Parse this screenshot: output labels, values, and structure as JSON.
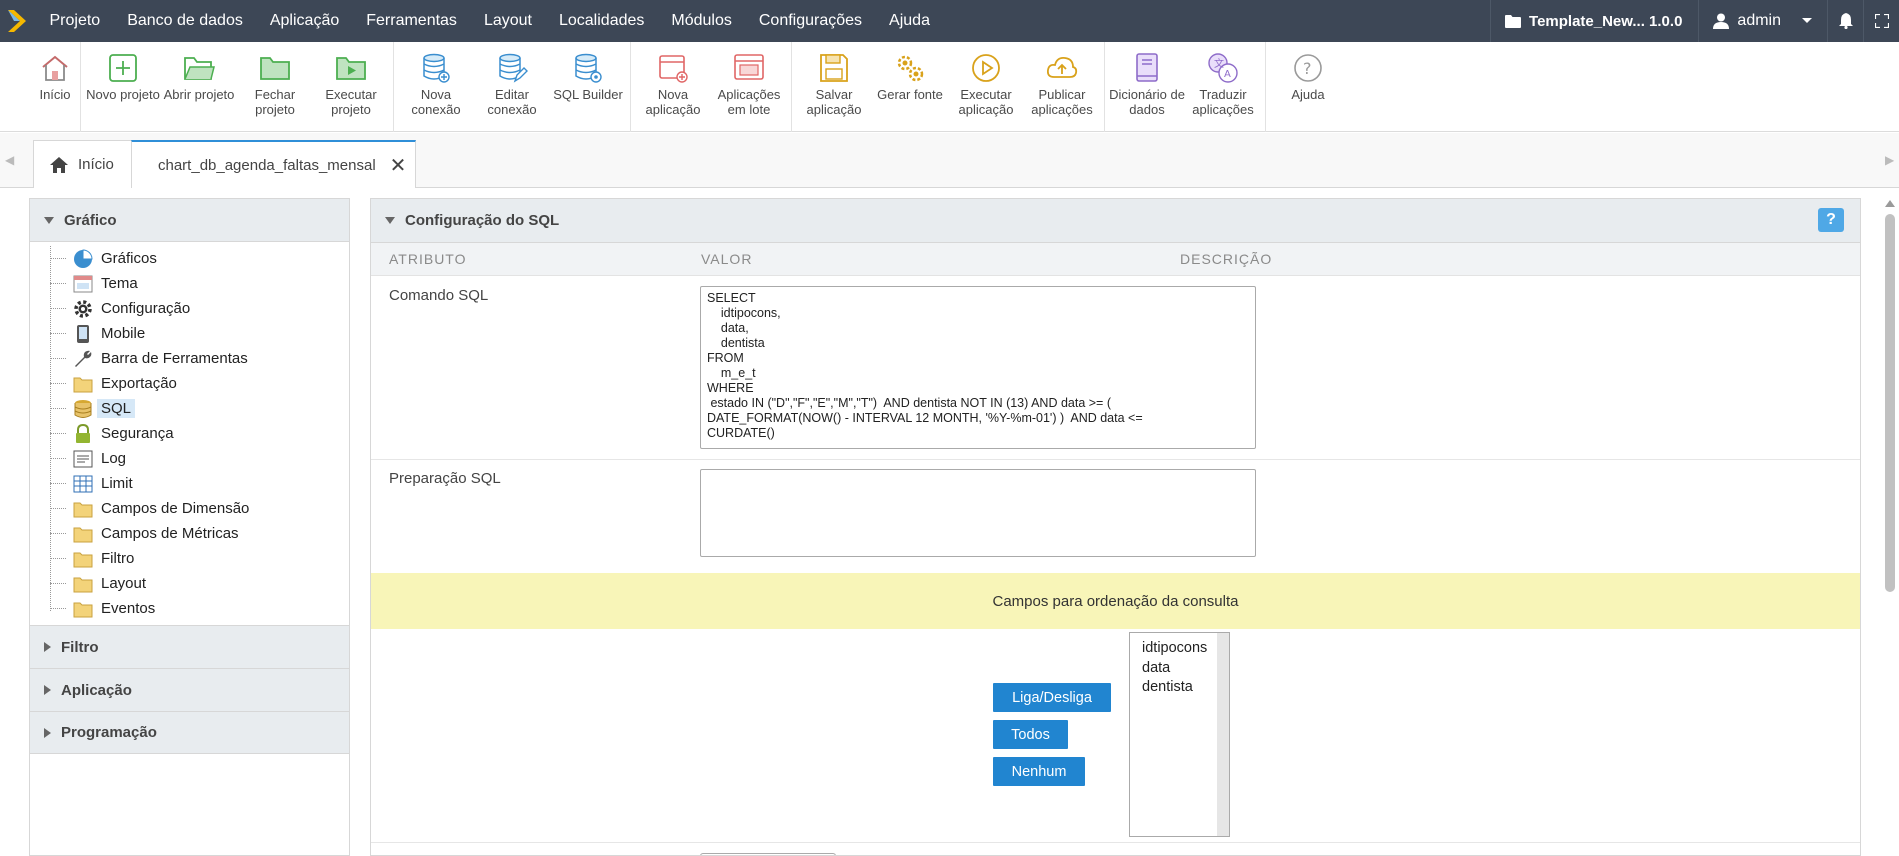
{
  "menubar": {
    "items": [
      "Projeto",
      "Banco de dados",
      "Aplicação",
      "Ferramentas",
      "Layout",
      "Localidades",
      "Módulos",
      "Configurações",
      "Ajuda"
    ],
    "project_name": "Template_New... 1.0.0",
    "user": "admin"
  },
  "toolbar": {
    "groups": [
      [
        {
          "label": "Início",
          "icon": "home-icon"
        }
      ],
      [
        {
          "label": "Novo projeto",
          "icon": "new-project-icon"
        },
        {
          "label": "Abrir projeto",
          "icon": "open-project-icon"
        },
        {
          "label": "Fechar projeto",
          "icon": "close-project-icon"
        },
        {
          "label": "Executar projeto",
          "icon": "run-project-icon"
        }
      ],
      [
        {
          "label": "Nova conexão",
          "icon": "new-connection-icon"
        },
        {
          "label": "Editar conexão",
          "icon": "edit-connection-icon"
        },
        {
          "label": "SQL Builder",
          "icon": "sql-builder-icon"
        }
      ],
      [
        {
          "label": "Nova aplicação",
          "icon": "new-app-icon"
        },
        {
          "label": "Aplicações em lote",
          "icon": "batch-apps-icon"
        }
      ],
      [
        {
          "label": "Salvar aplicação",
          "icon": "save-icon"
        },
        {
          "label": "Gerar fonte",
          "icon": "generate-source-icon"
        },
        {
          "label": "Executar aplicação",
          "icon": "run-app-icon"
        },
        {
          "label": "Publicar aplicações",
          "icon": "publish-icon"
        }
      ],
      [
        {
          "label": "Dicionário de dados",
          "icon": "dictionary-icon"
        },
        {
          "label": "Traduzir aplicações",
          "icon": "translate-icon"
        }
      ],
      [
        {
          "label": "Ajuda",
          "icon": "help-icon"
        }
      ]
    ]
  },
  "tabs": {
    "home": "Início",
    "active": "chart_db_agenda_faltas_mensal"
  },
  "sidebar": {
    "header": "Gráfico",
    "tree": [
      {
        "label": "Gráficos",
        "icon": "pie-chart-icon"
      },
      {
        "label": "Tema",
        "icon": "theme-icon"
      },
      {
        "label": "Configuração",
        "icon": "gear-icon"
      },
      {
        "label": "Mobile",
        "icon": "mobile-icon"
      },
      {
        "label": "Barra de Ferramentas",
        "icon": "wrench-icon"
      },
      {
        "label": "Exportação",
        "icon": "folder-icon"
      },
      {
        "label": "SQL",
        "icon": "database-icon",
        "selected": true
      },
      {
        "label": "Segurança",
        "icon": "lock-icon"
      },
      {
        "label": "Log",
        "icon": "log-icon"
      },
      {
        "label": "Limit",
        "icon": "grid-icon"
      },
      {
        "label": "Campos de Dimensão",
        "icon": "folder-icon"
      },
      {
        "label": "Campos de Métricas",
        "icon": "folder-icon"
      },
      {
        "label": "Filtro",
        "icon": "folder-icon"
      },
      {
        "label": "Layout",
        "icon": "folder-icon"
      },
      {
        "label": "Eventos",
        "icon": "folder-icon"
      }
    ],
    "sections": [
      "Filtro",
      "Aplicação",
      "Programação"
    ]
  },
  "main": {
    "title": "Configuração do SQL",
    "help": "?",
    "columns": {
      "attr": "ATRIBUTO",
      "value": "VALOR",
      "desc": "DESCRIÇÃO"
    },
    "sql_label": "Comando SQL",
    "sql_value": "SELECT\n    idtipocons,\n    data,\n    dentista\nFROM\n    m_e_t\nWHERE\n estado IN (\"D\",\"F\",\"E\",\"M\",\"T\")  AND dentista NOT IN (13) AND data >= (\nDATE_FORMAT(NOW() - INTERVAL 12 MONTH, '%Y-%m-01') )  AND data <=\nCURDATE()",
    "prep_label": "Preparação SQL",
    "prep_value": "",
    "order_title": "Campos para ordenação da consulta",
    "buttons": {
      "toggle": "Liga/Desliga",
      "all": "Todos",
      "none": "Nenhum"
    },
    "order_fields": [
      "idtipocons",
      "data",
      "dentista"
    ]
  },
  "colors": {
    "menubar": "#3d4756",
    "accent": "#2185d0",
    "highlight": "#f8f5b8"
  }
}
